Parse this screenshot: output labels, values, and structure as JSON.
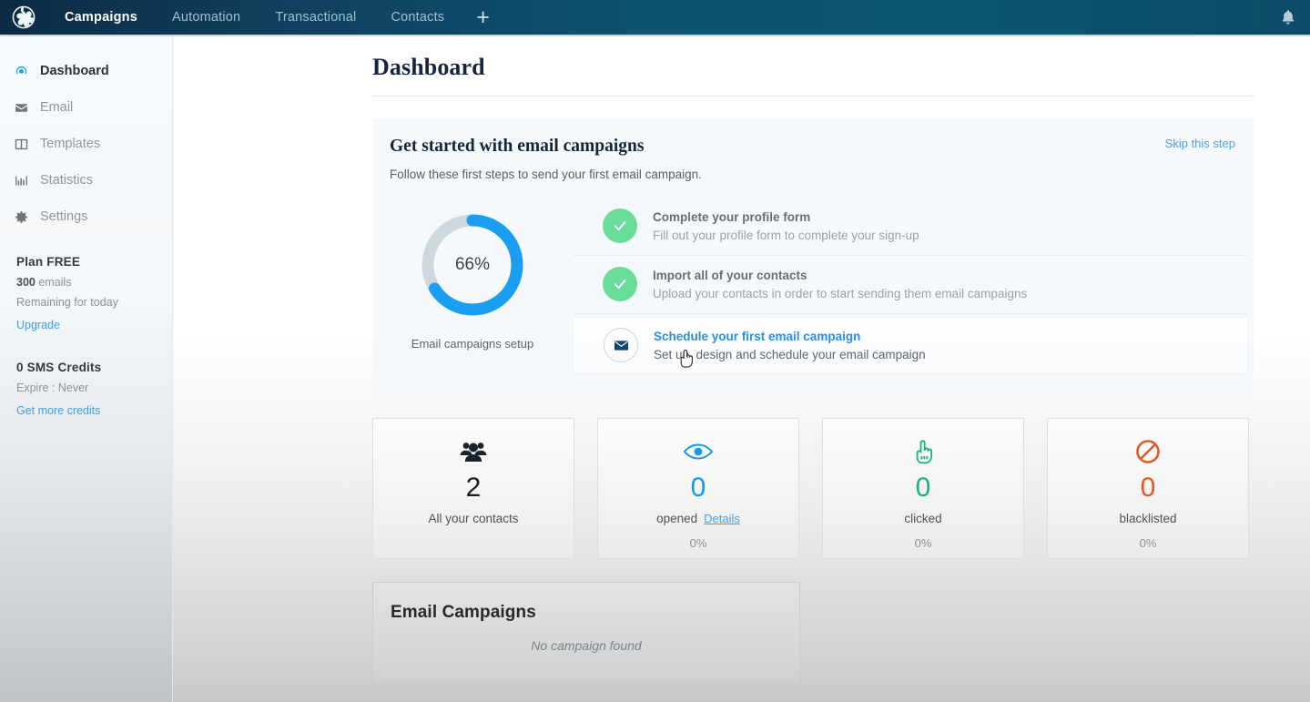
{
  "topbar": {
    "logo_icon": "pinwheel-logo-icon",
    "items": [
      {
        "label": "Campaigns",
        "active": true
      },
      {
        "label": "Automation",
        "active": false
      },
      {
        "label": "Transactional",
        "active": false
      },
      {
        "label": "Contacts",
        "active": false
      }
    ],
    "add_label": "+",
    "bell_icon": "bell-icon"
  },
  "sidebar": {
    "items": [
      {
        "label": "Dashboard",
        "icon": "dashboard-icon",
        "active": true
      },
      {
        "label": "Email",
        "icon": "envelope-icon",
        "active": false
      },
      {
        "label": "Templates",
        "icon": "templates-icon",
        "active": false
      },
      {
        "label": "Statistics",
        "icon": "bar-chart-icon",
        "active": false
      },
      {
        "label": "Settings",
        "icon": "gear-icon",
        "active": false
      }
    ],
    "plan": {
      "title": "Plan FREE",
      "quota_value": "300",
      "quota_unit": "emails",
      "remaining": "Remaining for today",
      "link": "Upgrade"
    },
    "sms": {
      "title": "0 SMS Credits",
      "expire": "Expire : Never",
      "link": "Get more credits"
    }
  },
  "page": {
    "title": "Dashboard"
  },
  "get_started": {
    "title": "Get started with email campaigns",
    "skip_label": "Skip this step",
    "subtitle": "Follow these first steps to send your first email campaign.",
    "progress": {
      "percent_label": "66%",
      "percent_value": 66,
      "caption": "Email campaigns setup",
      "ring_color": "#1a9ff0",
      "track_color": "#cfd8dd"
    },
    "steps": [
      {
        "title": "Complete your profile form",
        "desc": "Fill out your profile form to complete your sign-up",
        "state": "done",
        "icon": "check-icon"
      },
      {
        "title": "Import all of your contacts",
        "desc": "Upload your contacts in order to start sending them email campaigns",
        "state": "done",
        "icon": "check-icon"
      },
      {
        "title": "Schedule your first email campaign",
        "desc": "Set up, design and schedule your email campaign",
        "state": "pending",
        "icon": "envelope-icon"
      }
    ]
  },
  "stats": [
    {
      "icon": "users-group-icon",
      "value": "2",
      "label": "All your contacts",
      "details_label": "",
      "percent": "",
      "color": "#161d22"
    },
    {
      "icon": "eye-icon",
      "value": "0",
      "label": "opened",
      "details_label": "Details",
      "percent": "0%",
      "color": "#149ae8"
    },
    {
      "icon": "pointing-hand-icon",
      "value": "0",
      "label": "clicked",
      "details_label": "",
      "percent": "0%",
      "color": "#19b083"
    },
    {
      "icon": "no-entry-icon",
      "value": "0",
      "label": "blacklisted",
      "details_label": "",
      "percent": "0%",
      "color": "#e0592a"
    }
  ],
  "campaigns": {
    "title": "Email Campaigns",
    "empty_text": "No campaign found"
  }
}
